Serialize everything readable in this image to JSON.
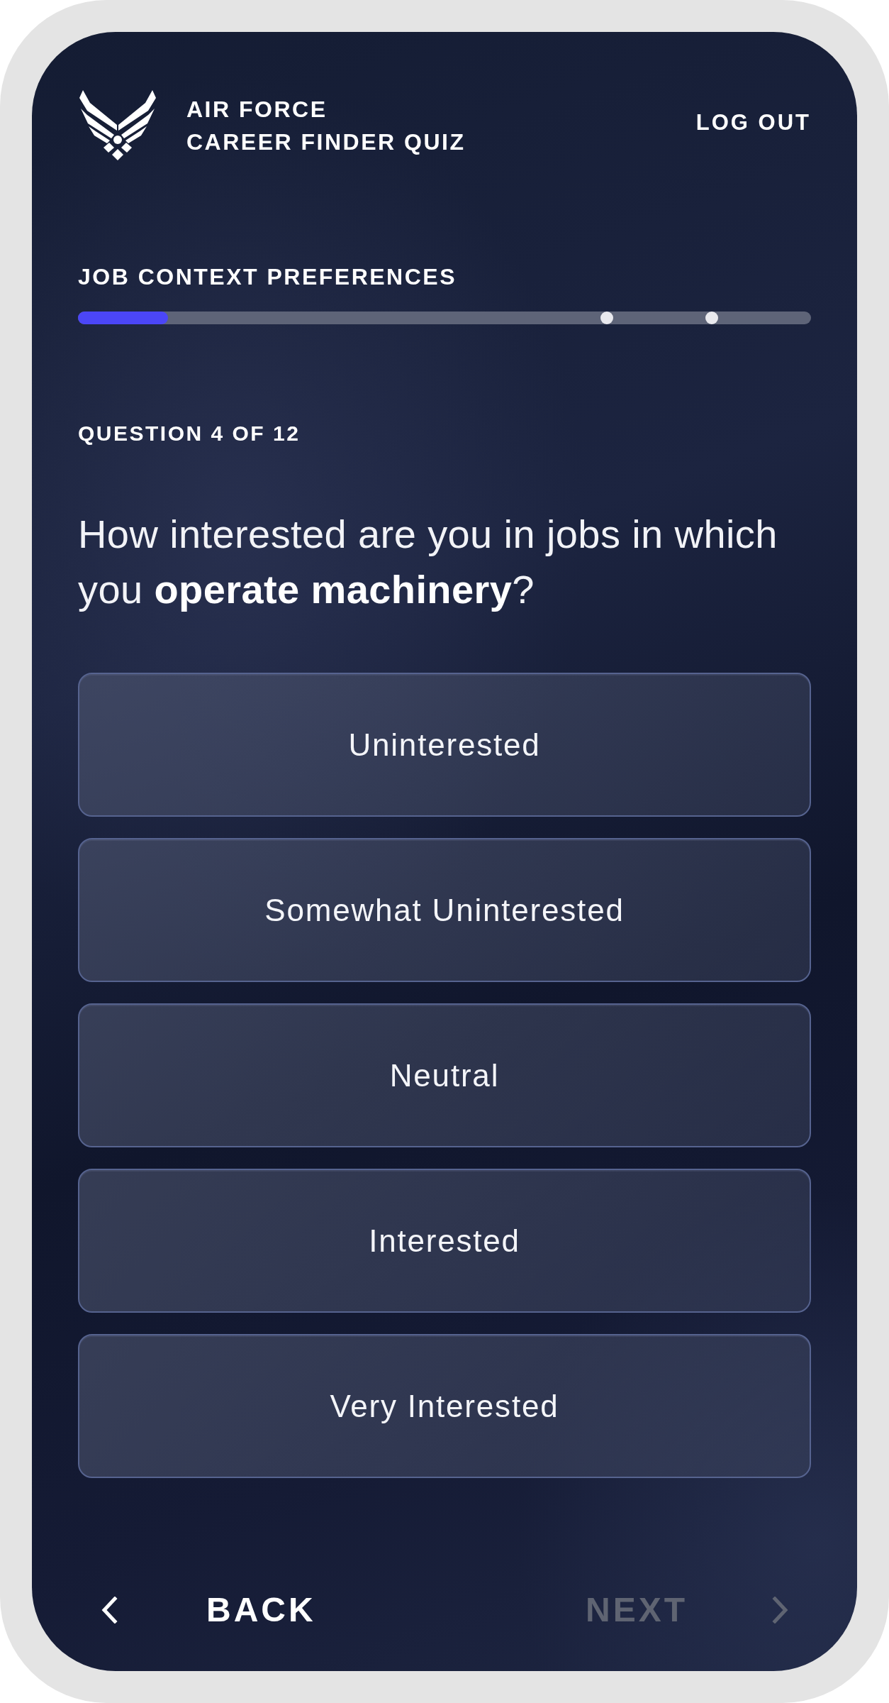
{
  "header": {
    "title": [
      "AIR FORCE",
      "CAREER FINDER QUIZ"
    ],
    "logout": "LOG OUT"
  },
  "progress": {
    "section": "JOB CONTEXT PREFERENCES",
    "level": 0.123
  },
  "question": {
    "counter": "QUESTION 4 OF 12",
    "text": "How interested are you in jobs in which you **operate machinery**?"
  },
  "options": [
    {
      "label": "Uninterested",
      "selected": false
    },
    {
      "label": "Somewhat Uninterested",
      "selected": false
    },
    {
      "label": "Neutral",
      "selected": false
    },
    {
      "label": "Interested",
      "selected": false
    },
    {
      "label": "Very Interested",
      "selected": false
    }
  ],
  "nav": {
    "back": {
      "label": "BACK",
      "disabled": false
    },
    "next": {
      "label": "NEXT",
      "disabled": true
    }
  }
}
